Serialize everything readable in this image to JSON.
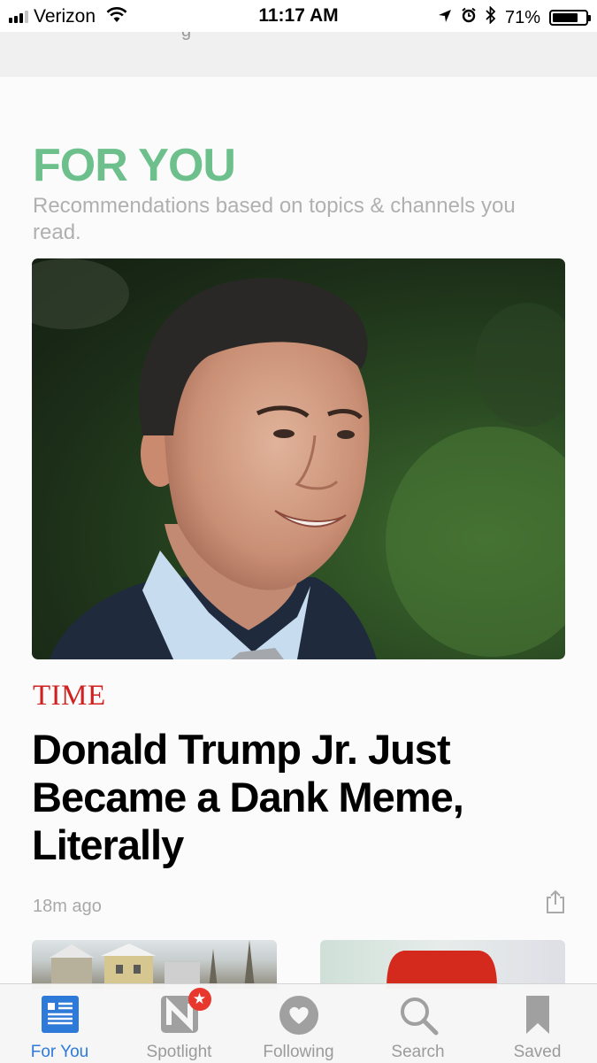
{
  "status_bar": {
    "carrier": "Verizon",
    "time": "11:17 AM",
    "battery": "71%"
  },
  "top_strip": {
    "partial_text": "g"
  },
  "section": {
    "title": "FOR YOU",
    "subtitle": "Recommendations based on topics & channels you read."
  },
  "article": {
    "publisher": "TIME",
    "headline": "Donald Trump Jr. Just Became a Dank Meme, Literally",
    "timestamp": "18m ago"
  },
  "tabs": [
    {
      "label": "For You",
      "icon": "for-you-icon",
      "active": true
    },
    {
      "label": "Spotlight",
      "icon": "spotlight-icon",
      "badge": "★"
    },
    {
      "label": "Following",
      "icon": "following-heart-icon"
    },
    {
      "label": "Search",
      "icon": "search-icon"
    },
    {
      "label": "Saved",
      "icon": "bookmark-icon"
    }
  ],
  "colors": {
    "section_title": "#6dc08c",
    "publisher": "#d0201f",
    "tab_active": "#2d7ad9",
    "tab_inactive": "#9b9b9b",
    "badge": "#e8372c"
  }
}
